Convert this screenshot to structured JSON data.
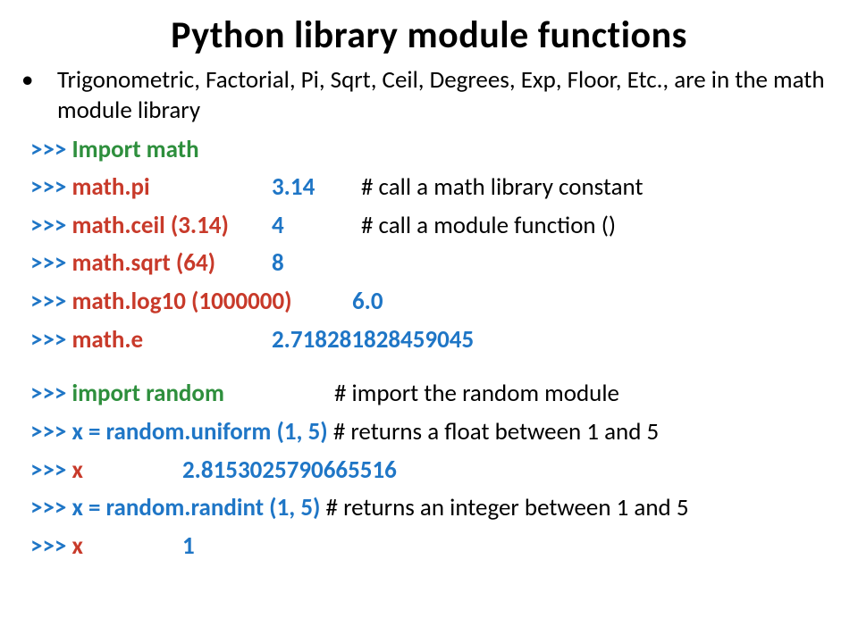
{
  "title": "Python library module functions",
  "intro": "Trigonometric, Factorial, Pi, Sqrt, Ceil, Degrees, Exp, Floor, Etc., are in the math module library",
  "bullet": "•",
  "rows": [
    {
      "prompt": ">>>",
      "code": "Import math",
      "code_color": "green",
      "result": "",
      "comment": "",
      "col2": 0
    },
    {
      "prompt": ">>>",
      "code": "math.pi",
      "code_color": "red",
      "result": "3.14",
      "comment": "# call a math library constant",
      "col2": 270,
      "col3": 370
    },
    {
      "prompt": ">>>",
      "code": "math.ceil (3.14)",
      "code_color": "red",
      "result": "4",
      "comment": "# call a module function ()",
      "col2": 270,
      "col3": 370
    },
    {
      "prompt": ">>>",
      "code": "math.sqrt (64)",
      "code_color": "red",
      "result": "8",
      "comment": "",
      "col2": 270
    },
    {
      "prompt": ">>>",
      "code": "math.log10 (1000000)",
      "code_color": "red",
      "result": "6.0",
      "comment": "",
      "col2": 360
    },
    {
      "prompt": ">>>",
      "code": "math.e",
      "code_color": "red",
      "result": "2.718281828459045",
      "comment": "",
      "col2": 270
    },
    {
      "spacer": true
    },
    {
      "prompt": ">>>",
      "code": "import random",
      "code_color": "green",
      "result": "",
      "comment": "# import the random module",
      "col3": 340
    },
    {
      "prompt": ">>>",
      "code": "x = random.uniform (1, 5)",
      "code_color": "blue",
      "result": "",
      "comment": "# returns a float between 1 and 5",
      "col3_inline": true
    },
    {
      "prompt": ">>>",
      "code": "x",
      "code_color": "red",
      "result": "2.8153025790665516",
      "comment": "",
      "col2": 170
    },
    {
      "prompt": ">>>",
      "code": "x = random.randint (1, 5)",
      "code_color": "blue",
      "result": "",
      "comment": "# returns an integer between 1 and 5",
      "col3_inline": true
    },
    {
      "prompt": ">>>",
      "code": "x",
      "code_color": "red",
      "result": "1",
      "comment": "",
      "col2": 170
    }
  ]
}
